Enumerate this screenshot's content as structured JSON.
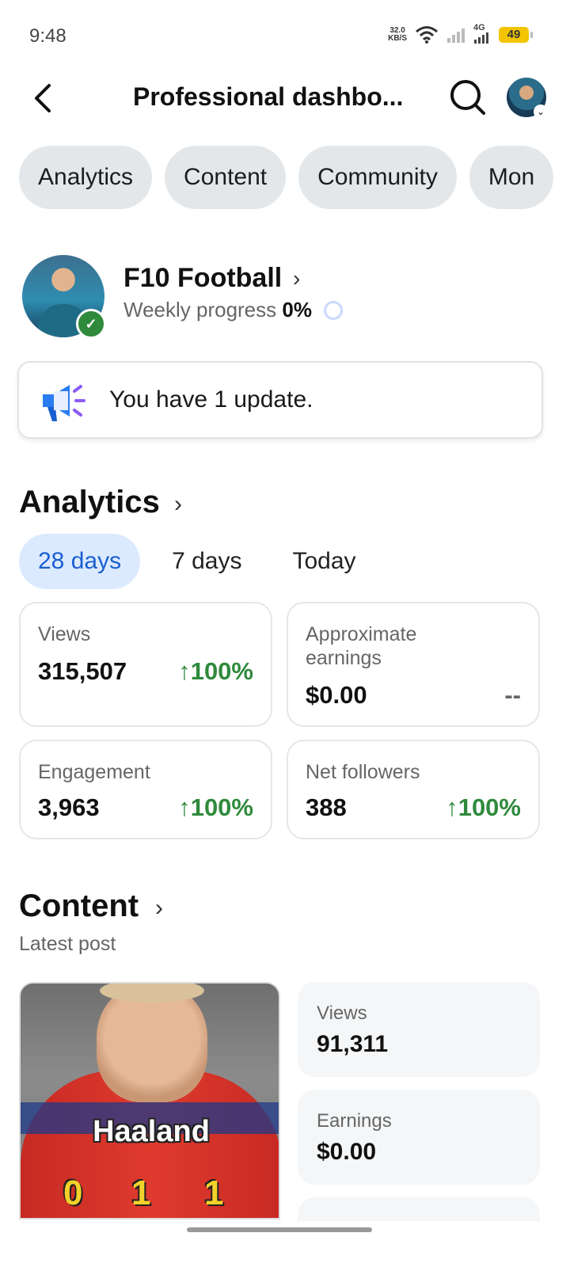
{
  "status_bar": {
    "time": "9:48",
    "net_speed_value": "32.0",
    "net_speed_unit": "KB/S",
    "network": "4G",
    "battery": "49"
  },
  "header": {
    "title": "Professional dashbo..."
  },
  "tabs": [
    "Analytics",
    "Content",
    "Community",
    "Mon"
  ],
  "profile": {
    "name": "F10 Football",
    "progress_label": "Weekly progress",
    "progress_value": "0%"
  },
  "update": {
    "text": "You have 1 update."
  },
  "analytics": {
    "title": "Analytics",
    "periods": [
      "28 days",
      "7 days",
      "Today"
    ],
    "active_period": "28 days",
    "metrics": [
      {
        "label": "Views",
        "value": "315,507",
        "change": "100%",
        "trend": "up"
      },
      {
        "label": "Approximate earnings",
        "value": "$0.00",
        "change": "--",
        "trend": "none"
      },
      {
        "label": "Engagement",
        "value": "3,963",
        "change": "100%",
        "trend": "up"
      },
      {
        "label": "Net followers",
        "value": "388",
        "change": "100%",
        "trend": "up"
      }
    ]
  },
  "content": {
    "title": "Content",
    "subtitle": "Latest post",
    "post": {
      "thumbnail_text": "Haaland",
      "score_digits": [
        "0",
        "1",
        "1"
      ]
    },
    "stats": [
      {
        "label": "Views",
        "value": "91,311"
      },
      {
        "label": "Earnings",
        "value": "$0.00"
      }
    ]
  },
  "colors": {
    "accent_blue": "#1a5fd0",
    "positive_green": "#2f8a3c",
    "tab_bg": "#e4e7ea"
  }
}
